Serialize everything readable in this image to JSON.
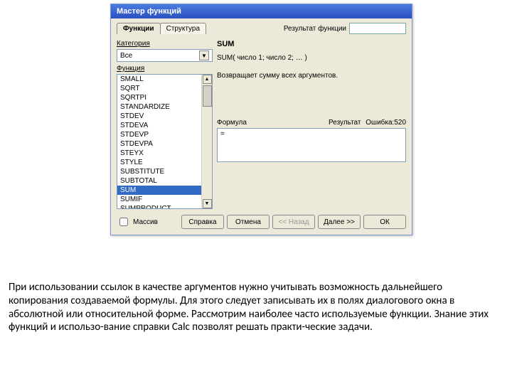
{
  "dialog": {
    "title": "Мастер функций",
    "tabs": {
      "functions": "Функции",
      "structure": "Структура"
    },
    "result_label": "Результат функции",
    "category_label": "Категория",
    "category_value": "Все",
    "function_label": "Функция",
    "functions_list": [
      "SMALL",
      "SQRT",
      "SQRTPI",
      "STANDARDIZE",
      "STDEV",
      "STDEVA",
      "STDEVP",
      "STDEVPA",
      "STEYX",
      "STYLE",
      "SUBSTITUTE",
      "SUBTOTAL",
      "SUM",
      "SUMIF",
      "SUMPRODUCT"
    ],
    "selected_function": "SUM",
    "func_signature": "SUM( число 1; число 2; … )",
    "func_description": "Возвращает сумму всех аргументов.",
    "formula_label": "Формула",
    "result2_label": "Результат",
    "result2_value": "Ошибка:520",
    "formula_value": "=",
    "array_checkbox": "Массив",
    "buttons": {
      "help": "Справка",
      "cancel": "Отмена",
      "back": "<< Назад",
      "next": "Далее >>",
      "ok": "ОК"
    }
  },
  "body_paragraph": "При использовании ссылок в качестве аргументов нужно учитывать возможность дальнейшего копирования создаваемой формулы. Для этого следует записывать их в полях диалогового окна в абсолютной или относительной форме. Рассмотрим наиболее часто используемые функции. Знание этих функций и использо-вание справки Calc позволят решать практи-ческие задачи."
}
